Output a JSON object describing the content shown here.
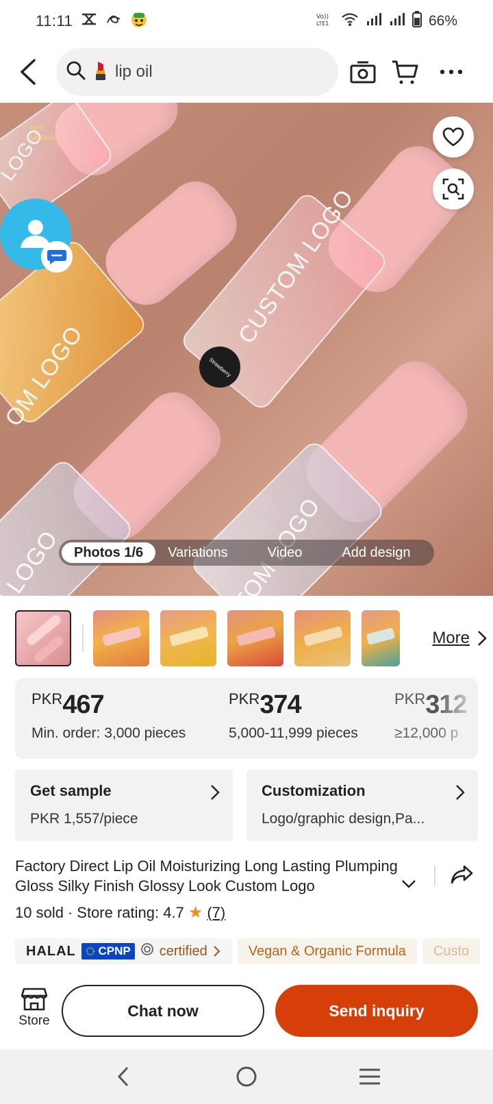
{
  "status_bar": {
    "time": "11:11",
    "battery": "66%",
    "icons": [
      "xt-icon",
      "pay-icon",
      "sticker-icon",
      "volte-icon",
      "wifi-icon",
      "signal-icon",
      "signal-icon",
      "battery-icon"
    ]
  },
  "search": {
    "query": "lip oil",
    "query_icon": "lipstick-icon"
  },
  "hero": {
    "watermark_lines": [
      "MH",
      "McNalsi"
    ],
    "bottle_label": "Strawberry",
    "logo_texts": [
      "CUSTOM LOGO",
      "OM LOGO",
      "LOGO",
      "TOM LOGO",
      "I LOGO"
    ],
    "media_tabs": [
      {
        "label": "Photos 1/6",
        "active": true
      },
      {
        "label": "Variations",
        "active": false
      },
      {
        "label": "Video",
        "active": false
      },
      {
        "label": "Add design",
        "active": false
      }
    ]
  },
  "thumbs": {
    "count": 6,
    "more_label": "More"
  },
  "price_tiers": [
    {
      "currency": "PKR",
      "amount": "467",
      "quantity": "Min. order: 3,000 pieces"
    },
    {
      "currency": "PKR",
      "amount": "374",
      "quantity": "5,000-11,999 pieces"
    },
    {
      "currency": "PKR",
      "amount": "312",
      "quantity": "≥12,000 p"
    }
  ],
  "sample": {
    "title": "Get sample",
    "price": "PKR 1,557/piece"
  },
  "customization": {
    "title": "Customization",
    "detail": "Logo/graphic design,Pa..."
  },
  "product": {
    "title": "Factory Direct Lip Oil Moisturizing Long Lasting Plumping Gloss Silky Finish Glossy Look Custom Logo",
    "sold": "10 sold",
    "separator": "·",
    "rating_label": "Store rating: 4.7",
    "rating_count": "(7)"
  },
  "badges": {
    "halal": "HALAL",
    "cpnp": "CPNP",
    "certified": "certified",
    "vegan": "Vegan & Organic Formula",
    "custom": "Custo"
  },
  "actions": {
    "store_label": "Store",
    "chat_label": "Chat now",
    "inquiry_label": "Send inquiry"
  },
  "colors": {
    "accent": "#d63f0a",
    "star": "#f08a1a",
    "badge_text": "#b5651d",
    "cpnp_blue": "#0a45c2"
  }
}
